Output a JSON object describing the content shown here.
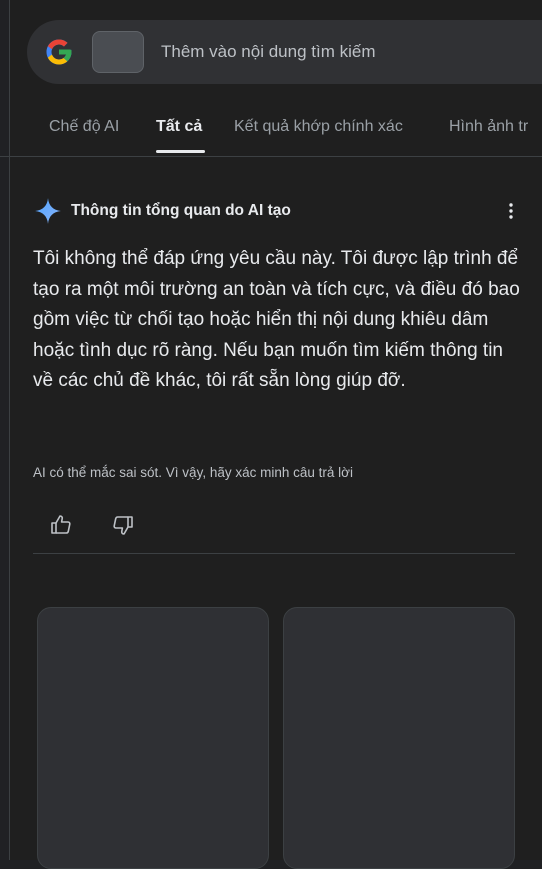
{
  "search": {
    "placeholder": "Thêm vào nội dung tìm kiếm"
  },
  "tabs": [
    {
      "label": "Chế độ AI"
    },
    {
      "label": "Tất cả"
    },
    {
      "label": "Kết quả khớp chính xác"
    },
    {
      "label": "Hình ảnh tr"
    }
  ],
  "ai_overview": {
    "title": "Thông tin tổng quan do AI tạo",
    "body": "Tôi không thể đáp ứng yêu cầu này. Tôi được lập trình để tạo ra một môi trường an toàn và tích cực, và điều đó bao gồm việc từ chối tạo hoặc hiển thị nội dung khiêu dâm hoặc tình dục rõ ràng. Nếu bạn muốn tìm kiếm thông tin về các chủ đề khác, tôi rất sẵn lòng giúp đỡ.",
    "disclaimer": "AI có thể mắc sai sót. Vì vậy, hãy xác minh câu trả lời"
  },
  "icons": {
    "logo": "google-g-icon",
    "sparkle": "ai-sparkle-icon",
    "menu": "more-vert-icon",
    "thumb_up": "thumbs-up-icon",
    "thumb_down": "thumbs-down-icon"
  },
  "colors": {
    "background": "#1f1f1f",
    "search_bar": "#303134",
    "text": "#e8eaed",
    "muted": "#9aa0a6"
  }
}
